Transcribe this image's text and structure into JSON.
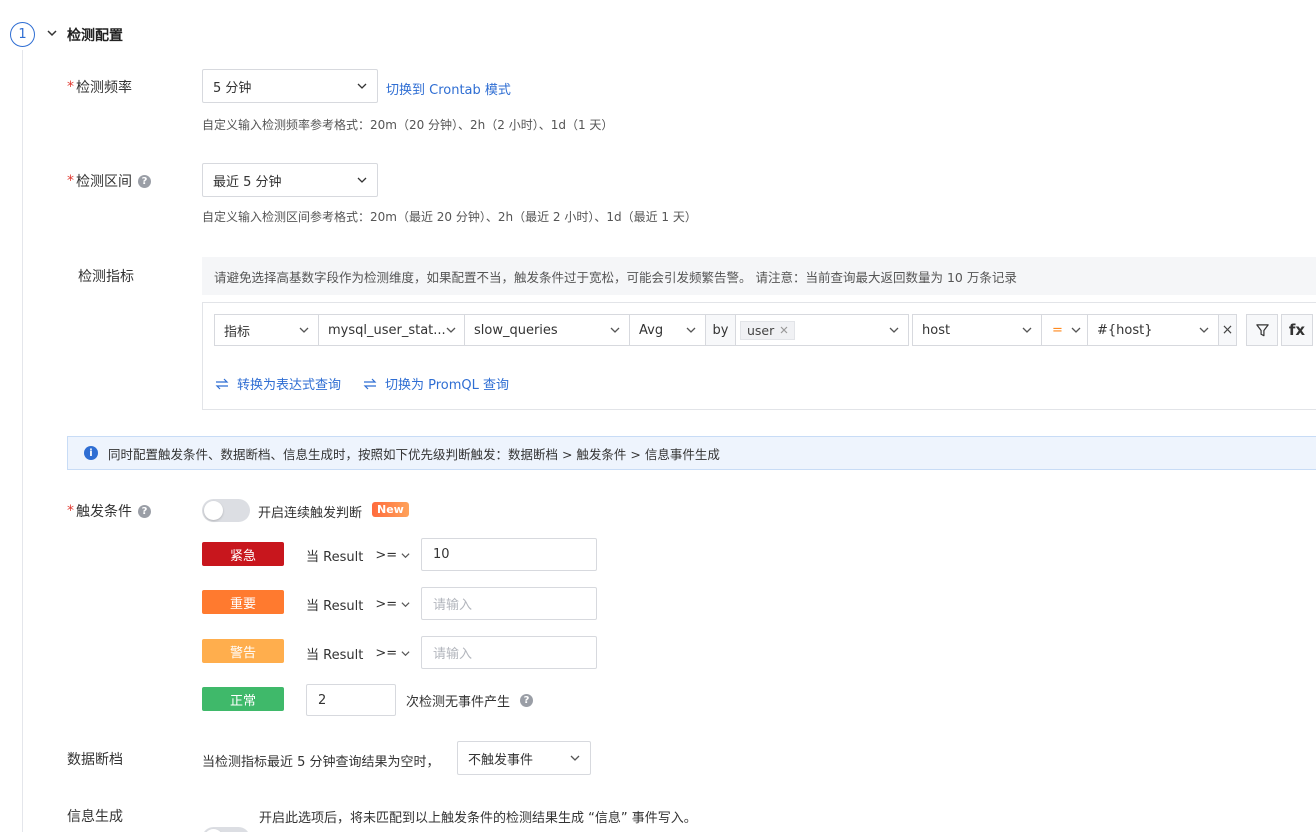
{
  "step": {
    "number": "1",
    "title": "检测配置"
  },
  "frequency": {
    "required": "*",
    "label": "检测频率",
    "value": "5 分钟",
    "switch_link": "切换到 Crontab 模式",
    "hint": "自定义输入检测频率参考格式：20m（20 分钟）、2h（2 小时）、1d（1 天）"
  },
  "interval": {
    "required": "*",
    "label": "检测区间",
    "value": "最近 5 分钟",
    "hint": "自定义输入检测区间参考格式：20m（最近 20 分钟）、2h（最近 2 小时）、1d（最近 1 天）"
  },
  "metric": {
    "label": "检测指标",
    "notice": "请避免选择高基数字段作为检测维度，如果配置不当，触发条件过于宽松，可能会引发频繁告警。 请注意：当前查询最大返回数量为 10 万条记录",
    "type": "指标",
    "measurement": "mysql_user_stat...",
    "field": "slow_queries",
    "aggregation": "Avg",
    "by_label": "by",
    "group_tag": "user",
    "filter_key": "host",
    "filter_op": "=",
    "filter_value": "#{host}",
    "clear_glyph": "×",
    "fx_label": "fx",
    "to_expression": "转换为表达式查询",
    "to_promql": "切换为 PromQL 查询"
  },
  "banner": {
    "icon_glyph": "i",
    "text": "同时配置触发条件、数据断档、信息生成时，按照如下优先级判断触发：数据断档 > 触发条件 > 信息事件生成"
  },
  "trigger": {
    "required": "*",
    "label": "触发条件",
    "toggle_label": "开启连续触发判断",
    "toggle_on": false,
    "new_badge": "New",
    "rows": [
      {
        "level": "紧急",
        "color": "#c8161d",
        "prefix": "当 Result",
        "op": ">=",
        "value": "10",
        "placeholder": ""
      },
      {
        "level": "重要",
        "color": "#ff7a2f",
        "prefix": "当 Result",
        "op": ">=",
        "value": "",
        "placeholder": "请输入"
      },
      {
        "level": "警告",
        "color": "#ffae4d",
        "prefix": "当 Result",
        "op": ">=",
        "value": "",
        "placeholder": "请输入"
      }
    ],
    "normal": {
      "level": "正常",
      "color": "#3fb96a",
      "value": "2",
      "suffix": "次检测无事件产生"
    }
  },
  "nodata": {
    "label": "数据断档",
    "text": "当检测指标最近 5 分钟查询结果为空时，",
    "value": "不触发事件"
  },
  "info": {
    "label": "信息生成",
    "toggle_on": false,
    "text": "开启此选项后，将未匹配到以上触发条件的检测结果生成 “信息” 事件写入。"
  }
}
